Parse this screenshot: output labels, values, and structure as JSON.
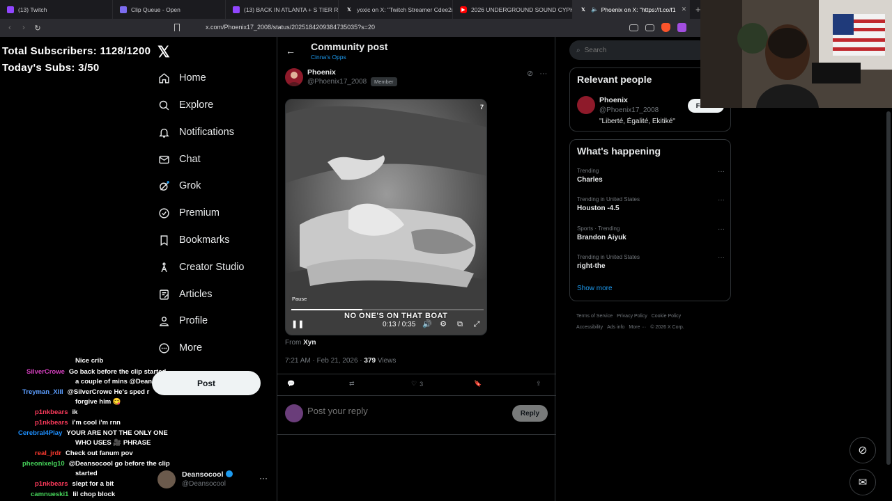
{
  "browser": {
    "tabs": [
      {
        "label": "(13) Twitch",
        "color": "#9146ff"
      },
      {
        "label": "Clip Queue - Open",
        "color": "#7c6cf0"
      },
      {
        "label": "(13) BACK IN ATLANTA + S TIER REA",
        "color": "#9146ff"
      },
      {
        "label": "yoxic on X: \"Twitch Streamer Cdee2m",
        "color": "#000000"
      },
      {
        "label": "2026 UNDERGROUND SOUND CYPH",
        "color": "#ff0000"
      },
      {
        "label": "Phoenix on X: \"https://t.co/f1",
        "color": "#000000"
      }
    ],
    "url": "x.com/Phoenix17_2008/status/2025184209384735035?s=20"
  },
  "overlay": {
    "total_subs": "Total Subscribers: 1128/1200",
    "today_subs": "Today's Subs: 3/50"
  },
  "nav": {
    "items": [
      {
        "label": "Home"
      },
      {
        "label": "Explore"
      },
      {
        "label": "Notifications"
      },
      {
        "label": "Chat"
      },
      {
        "label": "Grok"
      },
      {
        "label": "Premium"
      },
      {
        "label": "Bookmarks"
      },
      {
        "label": "Creator Studio"
      },
      {
        "label": "Articles"
      },
      {
        "label": "Profile"
      },
      {
        "label": "More"
      }
    ],
    "post_label": "Post",
    "account": {
      "name": "Deansocool",
      "handle": "@Deansocool"
    }
  },
  "chat": {
    "lines": [
      {
        "user": "",
        "color": "#ff4500",
        "msg": "Nice crib"
      },
      {
        "user": "SilverCrowe",
        "color": "#d43fbe",
        "msg": "Go back before the clip started"
      },
      {
        "user": "",
        "color": "#ffffff",
        "msg": "a couple of mins @Deansocool"
      },
      {
        "user": "Treyman_XIII",
        "color": "#5c9eff",
        "msg": "@SilverCrowe He's sped r"
      },
      {
        "user": "",
        "color": "#ffffff",
        "msg": "forgive him 😋"
      },
      {
        "user": "p1nkbears",
        "color": "#ff3b5c",
        "msg": "ik"
      },
      {
        "user": "p1nkbears",
        "color": "#ff3b5c",
        "msg": "i'm cool i'm rnn"
      },
      {
        "user": "Cerebral4Play",
        "color": "#1e90ff",
        "msg": "YOUR ARE NOT THE ONLY ONE"
      },
      {
        "user": "",
        "color": "#ffffff",
        "msg": "WHO USES 🎥 PHRASE"
      },
      {
        "user": "real_jrdr",
        "color": "#ff3b30",
        "msg": "Check out fanum pov"
      },
      {
        "user": "pheonixelg10",
        "color": "#46d35a",
        "msg": "@Deansocool go before the clip"
      },
      {
        "user": "",
        "color": "#ffffff",
        "msg": "started"
      },
      {
        "user": "p1nkbears",
        "color": "#ff3b5c",
        "msg": "slept for a bit"
      },
      {
        "user": "camnueski1",
        "color": "#46d35a",
        "msg": "lil chop block"
      }
    ]
  },
  "post": {
    "header_title": "Community post",
    "community": "Cinna's Opps",
    "author_name": "Phoenix",
    "author_handle": "@Phoenix17_2008",
    "member_badge": "Member",
    "video": {
      "badge": "7",
      "pause_tooltip": "Pause",
      "caption": "NO ONE'S ON THAT BOAT",
      "time": "0:13 / 0:35",
      "progress": 0.37
    },
    "from_label": "From",
    "from_name": "Xyn",
    "timestamp": "7:21 AM · Feb 21, 2026 ·",
    "views_count": "379",
    "views_label": "Views",
    "likes": "3",
    "reply_placeholder": "Post your reply",
    "reply_button": "Reply"
  },
  "sidebar": {
    "search_placeholder": "Search",
    "relevant_title": "Relevant people",
    "person": {
      "name": "Phoenix",
      "handle": "@Phoenix17_2008",
      "bio": "\"Liberté, Égalité, Ekitiké\"",
      "follow": "Follow"
    },
    "happening_title": "What's happening",
    "trends": [
      {
        "context": "Trending",
        "title": "Charles"
      },
      {
        "context": "Trending in United States",
        "title": "Houston -4.5"
      },
      {
        "context": "Sports · Trending",
        "title": "Brandon Aiyuk"
      },
      {
        "context": "Trending in United States",
        "title": "right-the"
      }
    ],
    "show_more": "Show more",
    "footer": [
      "Terms of Service",
      "Privacy Policy",
      "Cookie Policy",
      "Accessibility",
      "Ads info",
      "More ···",
      "© 2026 X Corp."
    ]
  }
}
